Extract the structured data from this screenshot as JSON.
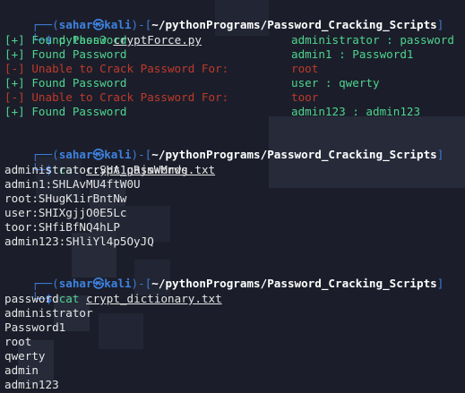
{
  "terminal": {
    "prompt_user": "sahar",
    "prompt_host": "kali",
    "prompt_path": "~/pythonPrograms/Password_Cracking_Scripts",
    "prompt_symbol": "$",
    "prompt_at": "㉿",
    "commands": [
      {
        "program": "python3",
        "arg": "cryptForce.py"
      },
      {
        "program": "cat",
        "arg": "crypt_passwords.txt"
      },
      {
        "program": "cat",
        "arg": "crypt_dictionary.txt"
      }
    ],
    "force_output": [
      {
        "status": "[+] Found Password",
        "result": "administrator : password",
        "ok": true
      },
      {
        "status": "[+] Found Password",
        "result": "admin1 : Password1",
        "ok": true
      },
      {
        "status": "[-] Unable to Crack Password For:",
        "result": "root",
        "ok": false
      },
      {
        "status": "[+] Found Password",
        "result": "user : qwerty",
        "ok": true
      },
      {
        "status": "[-] Unable to Crack Password For:",
        "result": "toor",
        "ok": false
      },
      {
        "status": "[+] Found Password",
        "result": "admin123 : admin123",
        "ok": true
      }
    ],
    "passwords_file": [
      "administrator:SHA1gRjmWMnwg",
      "admin1:SHLAvMU4ftW0U",
      "root:SHugK1irBntNw",
      "user:SHIXgjjO0E5Lc",
      "toor:SHfiBfNQ4hLP",
      "admin123:SHliYl4p5OyJQ"
    ],
    "dictionary_file": [
      "password",
      "administrator",
      "Password1",
      "root",
      "qwerty",
      "admin",
      "admin123"
    ]
  },
  "colors": {
    "background": "#1b1e2a",
    "prompt_blue": "#3d7bd6",
    "found_green": "#4fd48f",
    "fail_red": "#c0392b",
    "text": "#e6e6e6"
  }
}
